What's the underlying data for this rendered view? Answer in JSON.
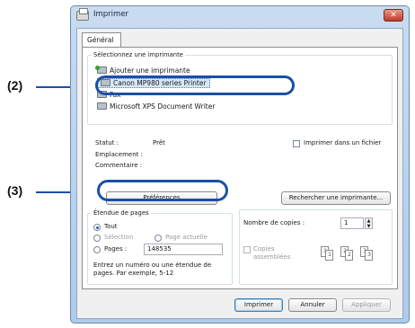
{
  "window": {
    "title": "Imprimer",
    "close_glyph": "✕"
  },
  "tabs": [
    {
      "label": "Général"
    }
  ],
  "printer_select": {
    "legend": "Sélectionnez une imprimante",
    "printers": [
      {
        "label": "Ajouter une imprimante",
        "icon": "add-printer-icon"
      },
      {
        "label": "Canon MP980 series Printer",
        "icon": "printer-icon",
        "selected": true
      },
      {
        "label": "Fax",
        "icon": "fax-icon"
      },
      {
        "label": "Microsoft XPS Document Writer",
        "icon": "printer-icon"
      }
    ]
  },
  "status": {
    "status_label": "Statut :",
    "status_value": "Prêt",
    "location_label": "Emplacement :",
    "comment_label": "Commentaire :",
    "print_to_file_label": "Imprimer dans un fichier",
    "preferences_button": "Préférences",
    "find_printer_button": "Rechercher une imprimante..."
  },
  "page_range": {
    "legend": "Étendue de pages",
    "all_label": "Tout",
    "selection_label": "Sélection",
    "current_page_label": "Page actuelle",
    "pages_label": "Pages :",
    "pages_value": "148535",
    "hint": "Entrez un numéro ou une étendue de pages. Par exemple, 5-12"
  },
  "copies": {
    "count_label": "Nombre de copies :",
    "count_value": "1",
    "collate_label": "Copies assemblées",
    "collate_pages": [
      "1",
      "1",
      "2",
      "2",
      "3",
      "3"
    ]
  },
  "buttons": {
    "print": "Imprimer",
    "cancel": "Annuler",
    "apply": "Appliquer"
  },
  "callouts": [
    {
      "label": "(2)"
    },
    {
      "label": "(3)"
    }
  ],
  "colors": {
    "callout": "#1b4fa8",
    "selection": "#d6e6f8",
    "window_frame": "#aecbe9"
  }
}
